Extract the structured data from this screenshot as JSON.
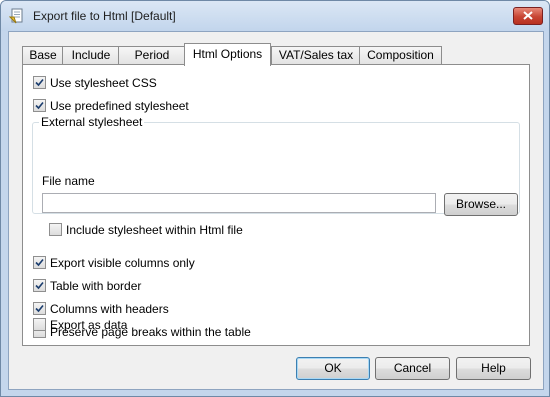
{
  "window": {
    "title": "Export file to Html [Default]"
  },
  "tabs": [
    {
      "label": "Base",
      "active": false
    },
    {
      "label": "Include",
      "active": false
    },
    {
      "label": "Period",
      "active": false
    },
    {
      "label": "Html Options",
      "active": true
    },
    {
      "label": "VAT/Sales tax",
      "active": false
    },
    {
      "label": "Composition",
      "active": false
    }
  ],
  "options": {
    "use_stylesheet_css": {
      "label": "Use stylesheet CSS",
      "checked": true
    },
    "use_predefined_stylesheet": {
      "label": "Use predefined stylesheet",
      "checked": true
    },
    "external_stylesheet": {
      "legend": "External stylesheet",
      "file_name_label": "File name",
      "file_name_value": "",
      "browse_label": "Browse...",
      "include_within_html": {
        "label": "Include stylesheet within Html file",
        "checked": false
      }
    },
    "export_visible_columns_only": {
      "label": "Export visible columns only",
      "checked": true
    },
    "table_with_border": {
      "label": "Table with border",
      "checked": true
    },
    "columns_with_headers": {
      "label": "Columns with headers",
      "checked": true
    },
    "preserve_page_breaks": {
      "label": "Preserve page breaks within the table",
      "checked": false
    },
    "export_as_data": {
      "label": "Export as data",
      "checked": false
    }
  },
  "buttons": {
    "ok": "OK",
    "cancel": "Cancel",
    "help": "Help"
  },
  "icons": {
    "app": "export-document-icon",
    "close": "close-icon",
    "check": "checkmark-icon"
  },
  "colors": {
    "title_bar": "#c4d6ec",
    "close_button": "#c74534",
    "default_button_border": "#3c7fb1"
  }
}
